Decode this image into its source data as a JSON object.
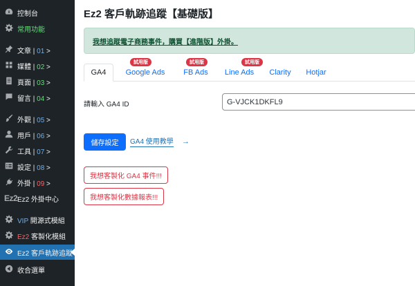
{
  "sidebar": {
    "items": [
      {
        "label": "控制台",
        "icon": "dashboard-icon"
      },
      {
        "label": "常用功能",
        "icon": "gear-icon"
      },
      {
        "label": "文章",
        "sep": " | ",
        "num": "01",
        "suffix": " >",
        "icon": "pin-icon"
      },
      {
        "label": "媒體",
        "sep": " | ",
        "num": "02",
        "suffix": " >",
        "icon": "media-icon"
      },
      {
        "label": "頁面",
        "sep": " | ",
        "num": "03",
        "suffix": " >",
        "icon": "page-icon"
      },
      {
        "label": "留言",
        "sep": " | ",
        "num": "04",
        "suffix": " >",
        "icon": "comment-icon"
      },
      {
        "label": "外觀",
        "sep": " | ",
        "num": "05",
        "suffix": " >",
        "icon": "brush-icon"
      },
      {
        "label": "用戶",
        "sep": " | ",
        "num": "06",
        "suffix": " >",
        "icon": "user-icon"
      },
      {
        "label": "工具",
        "sep": " | ",
        "num": "07",
        "suffix": " >",
        "icon": "wrench-icon"
      },
      {
        "label": "設定",
        "sep": " | ",
        "num": "08",
        "suffix": " >",
        "icon": "settings-icon"
      },
      {
        "label": "外掛",
        "sep": " | ",
        "num": "09",
        "suffix": " >",
        "icon": "plugin-icon"
      },
      {
        "label": "Ez2 外掛中心",
        "logo": "Ez2",
        "icon": "ez2-logo-icon"
      },
      {
        "prefix": "VIP",
        "label": " 開源式模組",
        "icon": "gear-icon"
      },
      {
        "prefix": "Ez2",
        "label": " 客製化模組",
        "icon": "gear-icon"
      },
      {
        "label": "Ez2 客戶軌跡追蹤",
        "icon": "eye-icon"
      },
      {
        "label": "收合選單",
        "icon": "collapse-icon"
      }
    ]
  },
  "main": {
    "title": "Ez2 客戶軌跡追蹤【基礎版】",
    "notice": "我想追蹤電子商務事件，購買【進階版】外掛。",
    "tabs": [
      {
        "label": "GA4"
      },
      {
        "label": "Google Ads",
        "badge": "試用版"
      },
      {
        "label": "FB Ads",
        "badge": "試用版"
      },
      {
        "label": "Line Ads",
        "badge": "試用版"
      },
      {
        "label": "Clarity"
      },
      {
        "label": "Hotjar"
      }
    ],
    "field_label": "請輸入 GA4 ID",
    "field_value": "G-VJCK1DKFL9",
    "save_label": "儲存設定",
    "tutorial_label": "GA4 使用教學",
    "arrow": "→",
    "custom_event_label": "我想客製化 GA4 事件!!!",
    "custom_report_label": "我想客製化數據報表!!!"
  },
  "colors": {
    "sidebar_bg": "#1d2327",
    "active_bg": "#2271b1",
    "primary": "#0d6efd",
    "danger": "#dc3545",
    "notice_bg": "#d1e7dd"
  }
}
